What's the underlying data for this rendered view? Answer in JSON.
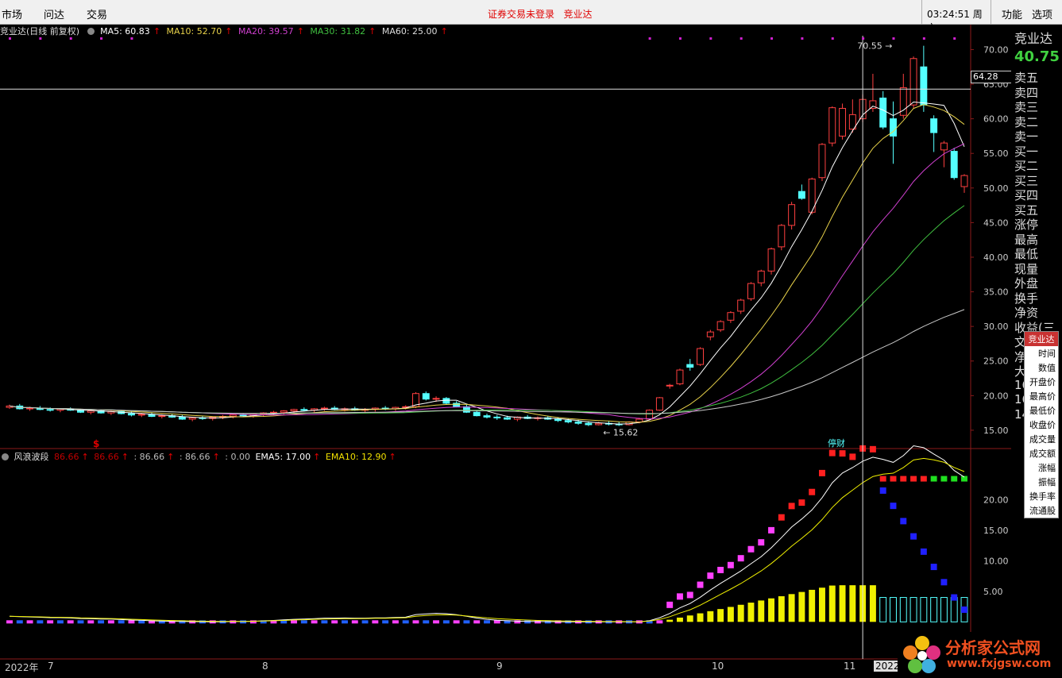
{
  "menu": {
    "market": "市场",
    "wenda": "问达",
    "trade": "交易",
    "notice": "证券交易未登录",
    "stock": "竞业达",
    "time": "03:24:51",
    "weekday": "周六",
    "func": "功能",
    "options": "选项"
  },
  "main_chart": {
    "title": "竞业达(日线 前复权)",
    "ma": [
      {
        "label": "MA5: 60.83",
        "color": "#ffffff"
      },
      {
        "label": "MA10: 52.70",
        "color": "#e8d24a"
      },
      {
        "label": "MA20: 39.57",
        "color": "#d040d0"
      },
      {
        "label": "MA30: 31.82",
        "color": "#40c040"
      },
      {
        "label": "MA60: 25.00",
        "color": "#c8c8c8"
      }
    ],
    "high_label": "70.55",
    "low_label": "15.62",
    "crosshair_price": "64.28",
    "tag": "停财"
  },
  "sub_chart": {
    "name": "风浪波段",
    "values": [
      "86.66",
      "86.66",
      ": 86.66",
      ": 86.66",
      ": 0.00"
    ],
    "ema5": "EMA5: 17.00",
    "ema10": "EMA10: 12.90",
    "signal": "$"
  },
  "time_axis": [
    "2022年",
    "7",
    "8",
    "9",
    "10",
    "11",
    "2022"
  ],
  "right_panel": {
    "name": "竞业达",
    "price": "40.75",
    "rows": [
      "卖五",
      "卖四",
      "卖三",
      "卖二",
      "卖一",
      "买一",
      "买二",
      "买三",
      "买四",
      "买五",
      "涨停",
      "最高",
      "最低",
      "现量",
      "外盘",
      "换手",
      "净资",
      "收益(三",
      "文",
      "净",
      "大",
      "16",
      "16",
      "14"
    ]
  },
  "popup": {
    "header": "竞业达",
    "items": [
      "时间",
      "数值",
      "开盘价",
      "最高价",
      "最低价",
      "收盘价",
      "成交量",
      "成交额",
      "涨幅",
      "振幅",
      "换手率",
      "流通股"
    ]
  },
  "watermark": {
    "title": "分析家公式网",
    "url": "www.fxjgsw.com"
  },
  "chart_data": [
    {
      "type": "candlestick",
      "title": "竞业达(日线 前复权)",
      "ylim": [
        13.5,
        72
      ],
      "y_ticks": [
        70.0,
        65.0,
        60.0,
        55.0,
        50.0,
        45.0,
        40.0,
        35.0,
        30.0,
        25.0,
        20.0,
        15.0
      ],
      "candles_ohlc": [
        [
          18.3,
          18.7,
          18.1,
          18.5
        ],
        [
          18.5,
          18.8,
          18.0,
          18.1
        ],
        [
          18.1,
          18.4,
          17.8,
          18.2
        ],
        [
          18.2,
          18.5,
          17.9,
          18.0
        ],
        [
          18.0,
          18.3,
          17.7,
          17.9
        ],
        [
          17.9,
          18.2,
          17.6,
          18.1
        ],
        [
          18.1,
          18.3,
          17.8,
          17.9
        ],
        [
          17.9,
          18.1,
          17.5,
          17.6
        ],
        [
          17.6,
          17.9,
          17.3,
          17.8
        ],
        [
          17.8,
          18.0,
          17.4,
          17.5
        ],
        [
          17.5,
          17.8,
          17.2,
          17.7
        ],
        [
          17.7,
          17.9,
          17.3,
          17.4
        ],
        [
          17.4,
          17.7,
          17.0,
          17.2
        ],
        [
          17.2,
          17.5,
          16.9,
          17.3
        ],
        [
          17.3,
          17.6,
          16.9,
          17.0
        ],
        [
          17.0,
          17.3,
          16.7,
          17.1
        ],
        [
          17.1,
          17.4,
          16.8,
          16.9
        ],
        [
          16.9,
          17.2,
          16.5,
          16.6
        ],
        [
          16.6,
          16.9,
          16.3,
          16.8
        ],
        [
          16.8,
          17.1,
          16.5,
          16.7
        ],
        [
          16.7,
          17.0,
          16.4,
          16.9
        ],
        [
          16.9,
          17.2,
          16.6,
          17.0
        ],
        [
          17.0,
          17.3,
          16.7,
          17.2
        ],
        [
          17.2,
          17.5,
          16.9,
          17.1
        ],
        [
          17.1,
          17.4,
          16.8,
          17.3
        ],
        [
          17.3,
          17.6,
          17.0,
          17.5
        ],
        [
          17.5,
          17.8,
          17.2,
          17.6
        ],
        [
          17.6,
          17.9,
          17.3,
          17.8
        ],
        [
          17.8,
          18.1,
          17.5,
          18.0
        ],
        [
          18.0,
          18.3,
          17.7,
          17.9
        ],
        [
          17.9,
          18.2,
          17.6,
          18.1
        ],
        [
          18.1,
          18.4,
          17.8,
          18.2
        ],
        [
          18.2,
          18.5,
          17.9,
          18.0
        ],
        [
          18.0,
          18.3,
          17.7,
          18.1
        ],
        [
          18.1,
          18.4,
          17.8,
          17.9
        ],
        [
          17.9,
          18.2,
          17.6,
          18.0
        ],
        [
          18.0,
          18.3,
          17.7,
          18.2
        ],
        [
          18.2,
          18.5,
          17.9,
          18.1
        ],
        [
          18.1,
          18.4,
          17.8,
          18.3
        ],
        [
          18.3,
          18.6,
          18.0,
          18.4
        ],
        [
          18.4,
          20.5,
          18.2,
          20.3
        ],
        [
          20.3,
          20.6,
          19.3,
          19.5
        ],
        [
          19.5,
          19.9,
          19.1,
          19.6
        ],
        [
          19.6,
          19.8,
          18.7,
          18.9
        ],
        [
          18.9,
          19.2,
          18.3,
          18.4
        ],
        [
          18.4,
          18.7,
          17.5,
          17.6
        ],
        [
          17.6,
          17.9,
          17.0,
          17.1
        ],
        [
          17.1,
          17.4,
          16.7,
          16.9
        ],
        [
          16.9,
          17.2,
          16.5,
          16.8
        ],
        [
          16.8,
          17.1,
          16.5,
          16.6
        ],
        [
          16.6,
          17.0,
          16.3,
          16.9
        ],
        [
          16.9,
          17.2,
          16.6,
          16.7
        ],
        [
          16.7,
          17.0,
          16.4,
          16.8
        ],
        [
          16.8,
          17.1,
          16.5,
          16.6
        ],
        [
          16.6,
          16.9,
          16.2,
          16.4
        ],
        [
          16.4,
          16.7,
          16.0,
          16.2
        ],
        [
          16.2,
          16.5,
          15.8,
          16.0
        ],
        [
          16.0,
          16.3,
          15.6,
          15.8
        ],
        [
          15.8,
          16.2,
          15.7,
          16.0
        ],
        [
          16.0,
          16.3,
          15.7,
          15.9
        ],
        [
          15.9,
          16.2,
          15.62,
          15.8
        ],
        [
          15.8,
          16.3,
          15.7,
          16.2
        ],
        [
          16.2,
          16.8,
          16.0,
          16.6
        ],
        [
          16.6,
          18.0,
          16.5,
          17.9
        ],
        [
          17.9,
          19.8,
          17.8,
          19.7
        ],
        [
          21.5,
          21.7,
          21.0,
          21.5
        ],
        [
          21.7,
          23.9,
          21.5,
          23.7
        ],
        [
          24.5,
          25.3,
          23.6,
          24.1
        ],
        [
          24.5,
          27.0,
          24.3,
          26.8
        ],
        [
          28.5,
          29.5,
          28.0,
          29.2
        ],
        [
          29.5,
          30.9,
          29.2,
          30.7
        ],
        [
          30.9,
          32.2,
          30.5,
          32.0
        ],
        [
          32.2,
          34.0,
          31.8,
          33.8
        ],
        [
          34.0,
          36.4,
          33.7,
          36.2
        ],
        [
          36.3,
          38.2,
          35.8,
          38.0
        ],
        [
          38.0,
          41.4,
          37.5,
          41.2
        ],
        [
          41.5,
          44.8,
          41.0,
          44.6
        ],
        [
          44.6,
          48.0,
          44.0,
          47.6
        ],
        [
          49.5,
          50.5,
          48.3,
          48.5
        ],
        [
          46.5,
          51.5,
          46.2,
          51.3
        ],
        [
          51.5,
          56.5,
          51.0,
          56.3
        ],
        [
          56.5,
          61.8,
          56.0,
          61.6
        ],
        [
          57.5,
          62.2,
          57.0,
          61.5
        ],
        [
          58.5,
          62.8,
          58.0,
          60.6
        ],
        [
          60.0,
          63.5,
          59.5,
          62.8
        ],
        [
          61.5,
          66.5,
          61.0,
          62.6
        ],
        [
          63.0,
          64.0,
          58.5,
          58.8
        ],
        [
          60.0,
          62.5,
          53.5,
          57.5
        ],
        [
          60.5,
          66.5,
          60.0,
          64.5
        ],
        [
          62.0,
          69.0,
          61.5,
          68.7
        ],
        [
          67.5,
          70.55,
          61.0,
          62.0
        ],
        [
          60.0,
          60.5,
          55.2,
          58.0
        ],
        [
          55.5,
          56.8,
          53.0,
          56.5
        ],
        [
          55.3,
          55.8,
          51.2,
          51.5
        ],
        [
          50.2,
          52.0,
          49.3,
          51.8
        ]
      ],
      "series": [
        {
          "name": "MA5",
          "values": [
            60.83
          ]
        },
        {
          "name": "MA10",
          "values": [
            52.7
          ]
        },
        {
          "name": "MA20",
          "values": [
            39.57
          ]
        },
        {
          "name": "MA30",
          "values": [
            31.82
          ]
        },
        {
          "name": "MA60",
          "values": [
            25.0
          ]
        }
      ]
    },
    {
      "type": "bar",
      "title": "风浪波段",
      "ylim": [
        -1,
        25
      ],
      "y_ticks": [
        20.0,
        15.0,
        10.0,
        5.0
      ],
      "series": [
        {
          "name": "EMA5",
          "values": [
            17.0
          ]
        },
        {
          "name": "EMA10",
          "values": [
            12.9
          ]
        }
      ]
    }
  ]
}
